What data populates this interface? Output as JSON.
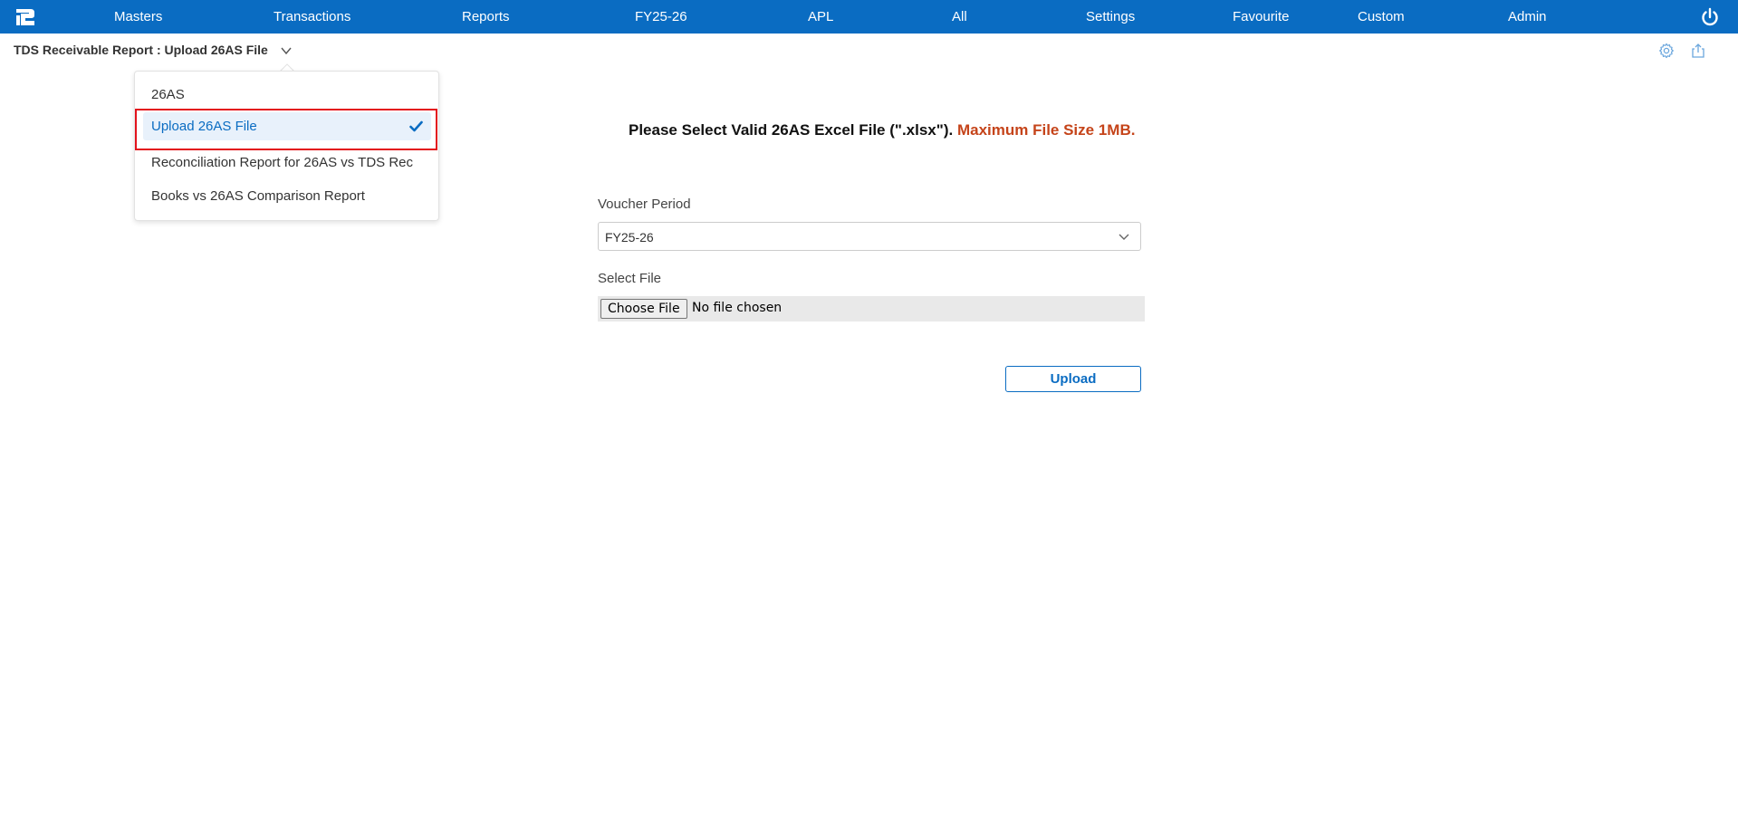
{
  "nav": {
    "items": [
      "Masters",
      "Transactions",
      "Reports",
      "FY25-26",
      "APL",
      "All",
      "Settings",
      "Favourite",
      "Custom",
      "Admin"
    ]
  },
  "header": {
    "title": "TDS Receivable Report : Upload 26AS File"
  },
  "menu": {
    "items": [
      {
        "label": "26AS",
        "selected": false
      },
      {
        "label": "Upload 26AS File",
        "selected": true
      },
      {
        "label": "Reconciliation Report for 26AS vs TDS Rec",
        "selected": false
      },
      {
        "label": "Books vs 26AS Comparison Report",
        "selected": false
      }
    ]
  },
  "form": {
    "instruction_main": "Please Select Valid 26AS Excel File (\".xlsx\").",
    "instruction_note": "Maximum File Size 1MB.",
    "voucher_period_label": "Voucher Period",
    "voucher_period_value": "FY25-26",
    "select_file_label": "Select File",
    "choose_file_label": "Choose File",
    "file_status": "No file chosen",
    "upload_label": "Upload"
  },
  "icons": {
    "logo": "app-logo-icon",
    "power": "power-icon",
    "settings": "gear-icon",
    "export": "share-icon",
    "chevron": "chevron-down-icon",
    "check": "checkmark-icon"
  },
  "colors": {
    "primary": "#0a6cc2",
    "note": "#c5441a",
    "highlight": "#e3121b",
    "selected_bg": "#e8f1fb"
  }
}
